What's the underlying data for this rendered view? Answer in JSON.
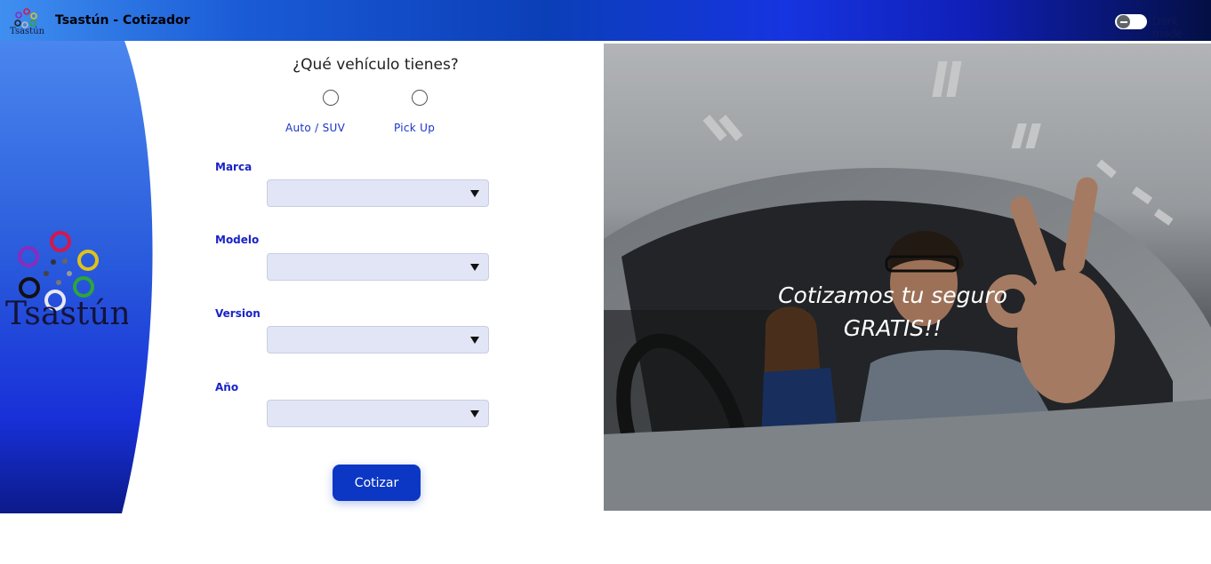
{
  "header": {
    "title": "Tsastún - Cotizador",
    "logo_text": "Tsastún",
    "dark_mode_label": "Dark mode"
  },
  "sidebar": {
    "logo_text": "Tsastún"
  },
  "form": {
    "question": "¿Qué vehículo tienes?",
    "vehicle_types": [
      {
        "label": "Auto / SUV",
        "selected": false
      },
      {
        "label": "Pick Up",
        "selected": false
      }
    ],
    "fields": [
      {
        "label": "Marca",
        "value": ""
      },
      {
        "label": "Modelo",
        "value": ""
      },
      {
        "label": "Version",
        "value": ""
      },
      {
        "label": "Año",
        "value": ""
      }
    ],
    "submit_label": "Cotizar"
  },
  "hero": {
    "line1": "Cotizamos tu seguro",
    "line2": "GRATIS!!"
  },
  "colors": {
    "accent": "#0c37c4",
    "label": "#1a22c6",
    "select_bg": "#e1e5f5"
  }
}
